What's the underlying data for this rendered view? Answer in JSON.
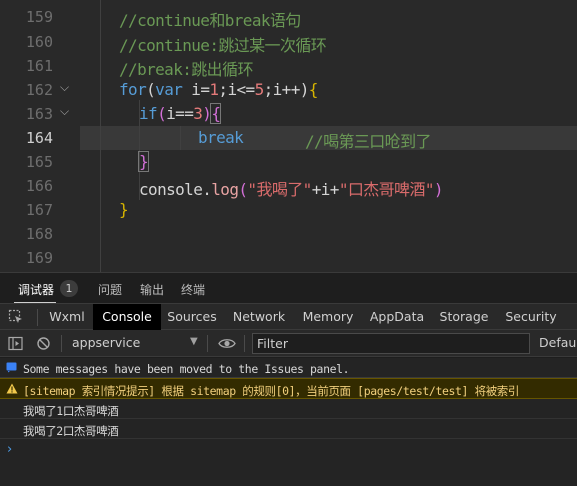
{
  "editor": {
    "lines": [
      {
        "num": "159"
      },
      {
        "num": "160"
      },
      {
        "num": "161"
      },
      {
        "num": "162"
      },
      {
        "num": "163"
      },
      {
        "num": "164"
      },
      {
        "num": "165"
      },
      {
        "num": "166"
      },
      {
        "num": "167"
      },
      {
        "num": "168"
      },
      {
        "num": "169"
      }
    ],
    "code": {
      "c159": "//continue和break语句",
      "c160": "//continue:跳过某一次循环",
      "c161": "//break:跳出循环",
      "c162_for": "for",
      "c162_var": "var",
      "c162_rest_a": " i=",
      "c162_n1": "1",
      "c162_rest_b": ";i<=",
      "c162_n5": "5",
      "c162_rest_c": ";i++)",
      "c162_open_paren": "(",
      "c162_brace": "{",
      "c163_if": "if",
      "c163_paren_open": "(",
      "c163_mid": "i==",
      "c163_n3": "3",
      "c163_paren_close": ")",
      "c163_brace": "{",
      "c164_break": "break",
      "c164_comment": "//喝第三口呛到了",
      "c165_brace": "}",
      "c166_obj": "console.",
      "c166_fn": "log",
      "c166_p1": "(",
      "c166_s1": "\"我喝了\"",
      "c166_plus1": "+i+",
      "c166_s2": "\"口杰哥啤酒\"",
      "c166_p2": ")",
      "c167_brace": "}"
    }
  },
  "panel_tabs": {
    "debugger": "调试器",
    "badge": "1",
    "issues": "问题",
    "output": "输出",
    "terminal": "终端"
  },
  "devtools_tabs": [
    "Wxml",
    "Console",
    "Sources",
    "Network",
    "Memory",
    "AppData",
    "Storage",
    "Security"
  ],
  "console_toolbar": {
    "context": "appservice",
    "filter_placeholder": "Filter",
    "levels": "Default"
  },
  "console": {
    "info": "Some messages have been moved to the Issues panel.",
    "warning": "[sitemap 索引情况提示] 根据 sitemap 的规则[0]，当前页面 [pages/test/test] 将被索引",
    "log1": "我喝了1口杰哥啤酒",
    "log2": "我喝了2口杰哥啤酒",
    "prompt": "›"
  },
  "colors": {
    "accent_console_tab": "#000000",
    "warning_bg": "#332b00",
    "info_icon": "#3b82f6",
    "warning_icon": "#f2c94c"
  }
}
